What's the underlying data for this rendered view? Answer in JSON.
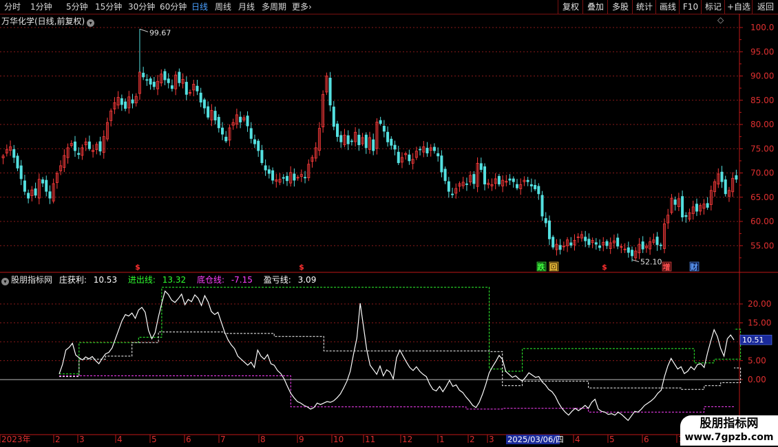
{
  "toolbar": {
    "timeframes": [
      "分时",
      "1分钟",
      "5分钟",
      "15分钟",
      "30分钟",
      "60分钟",
      "日线",
      "周线",
      "月线",
      "多周期",
      "更多"
    ],
    "active": "日线",
    "more_chevron": "›",
    "right_buttons": [
      "复权",
      "叠加",
      "多股",
      "统计",
      "画线",
      "F10",
      "标记",
      "+自选",
      "返回"
    ]
  },
  "main_chart": {
    "title": "万华化学(日线,前复权)",
    "diamond_icon": "◇",
    "max_label": "99.67",
    "min_label": "52.10",
    "y_ticks": [
      "100.0",
      "95.00",
      "90.00",
      "85.00",
      "80.00",
      "75.00",
      "70.00",
      "65.00",
      "60.00",
      "55.00"
    ],
    "markers": [
      {
        "text": "$",
        "color": "#ff3030"
      },
      {
        "text": "$",
        "color": "#ff3030"
      },
      {
        "text": "跌",
        "color": "#40ff40",
        "bg": "#105010"
      },
      {
        "text": "回",
        "color": "#ffd040",
        "bg": "#5a4010"
      },
      {
        "text": "$",
        "color": "#ff3030"
      },
      {
        "text": "增",
        "color": "#ff5050",
        "bg": "#501010"
      },
      {
        "text": "财",
        "color": "#60a0ff",
        "bg": "#102050"
      }
    ]
  },
  "indicator": {
    "name": "股朋指标网",
    "items": [
      {
        "label": "庄获利:",
        "value": "10.53",
        "color": "#ffffff"
      },
      {
        "label": "进出线:",
        "value": "13.32",
        "color": "#30ff30"
      },
      {
        "label": "底仓线:",
        "value": "-7.15",
        "color": "#ff40ff"
      },
      {
        "label": "盈亏线:",
        "value": "3.09",
        "color": "#ffffff"
      }
    ],
    "y_ticks": [
      "20.00",
      "15.00",
      "10.00",
      "5.00",
      "0.00"
    ],
    "current_value": "10.51"
  },
  "x_axis": {
    "labels": [
      "2023年",
      "2",
      "3",
      "4",
      "5",
      "6",
      "7",
      "8",
      "9",
      "10",
      "11",
      "12",
      "1",
      "2",
      "3",
      "4",
      "5",
      "6",
      "7"
    ],
    "highlight": "2025/03/06/四"
  },
  "watermark": {
    "line1": "股朋指标网",
    "line2": "www.7gpzb.com"
  },
  "colors": {
    "up": "#ff3c3c",
    "down": "#54e0e0",
    "grid": "#8b1a1a",
    "axis": "#c01818",
    "green_line": "#30ff30",
    "magenta_line": "#ff40ff"
  },
  "chart_data": {
    "type": "candlestick",
    "close_series": [
      73.5,
      74.8,
      75.4,
      73.2,
      71.0,
      68.8,
      66.2,
      64.8,
      66.5,
      65.4,
      68.7,
      67.9,
      66.2,
      64.8,
      67.8,
      69.9,
      71.5,
      73.6,
      75.2,
      76.1,
      74.6,
      73.8,
      75.2,
      76.4,
      75.0,
      74.7,
      75.9,
      74.5,
      77.5,
      80.4,
      82.8,
      84.5,
      85.6,
      84.1,
      83.3,
      85.7,
      84.4,
      85.8,
      90.8,
      89.8,
      89.1,
      88.3,
      87.8,
      88.9,
      90.4,
      89.2,
      88.6,
      87.4,
      90.2,
      88.6,
      89.3,
      86.2,
      86.6,
      88.3,
      86.9,
      84.6,
      83.4,
      81.5,
      82.9,
      80.9,
      79.3,
      78.0,
      76.6,
      79.3,
      80.4,
      82.0,
      80.5,
      81.4,
      79.7,
      77.1,
      76.0,
      74.6,
      72.1,
      70.6,
      69.9,
      68.5,
      68.6,
      68.7,
      68.9,
      68.4,
      70.1,
      68.5,
      69.1,
      69.7,
      69.0,
      71.8,
      73.2,
      75.2,
      79.2,
      86.2,
      90.0,
      84.0,
      79.6,
      77.5,
      76.4,
      77.8,
      76.0,
      76.5,
      78.4,
      75.8,
      77.3,
      75.2,
      77.3,
      74.6,
      80.5,
      80.2,
      78.6,
      76.4,
      75.7,
      74.9,
      72.1,
      73.2,
      74.0,
      72.5,
      72.8,
      74.5,
      74.8,
      75.4,
      74.1,
      75.2,
      74.6,
      73.5,
      70.2,
      68.4,
      66.2,
      65.5,
      66.8,
      67.8,
      68.1,
      67.6,
      69.5,
      67.8,
      72.0,
      70.7,
      67.7,
      67.9,
      67.6,
      68.8,
      67.7,
      68.5,
      68.3,
      68.5,
      68.2,
      66.9,
      67.6,
      68.5,
      68.2,
      67.3,
      66.7,
      65.7,
      61.1,
      59.7,
      56.4,
      54.7,
      55.3,
      54.2,
      54.9,
      56.2,
      55.1,
      56.1,
      56.8,
      57.3,
      56.0,
      55.2,
      56.1,
      55.3,
      54.6,
      55.7,
      55.0,
      55.6,
      56.0,
      54.9,
      54.8,
      54.3,
      53.6,
      52.9,
      53.9,
      55.3,
      54.3,
      54.9,
      55.8,
      56.2,
      55.2,
      55.0,
      59.5,
      61.3,
      64.8,
      63.5,
      64.7,
      60.9,
      61.0,
      61.8,
      63.0,
      62.1,
      63.3,
      63.6,
      62.9,
      66.4,
      68.2,
      69.8,
      68.2,
      65.7,
      66.4,
      68.9,
      68.7
    ],
    "price_max": 99.67,
    "price_min": 52.1,
    "indicator_series": {
      "庄获利": [
        1.5,
        4,
        7.8,
        8.5,
        9.6,
        6.5,
        5.8,
        5.2,
        6.0,
        5.5,
        6.1,
        5.0,
        4.2,
        5.6,
        6.8,
        7.2,
        8.4,
        10.8,
        13.2,
        15.6,
        17.2,
        16.8,
        17.6,
        16.2,
        18.4,
        19.1,
        17.8,
        13.0,
        10.8,
        12.4,
        16.6,
        20.2,
        23.4,
        22.5,
        21.0,
        20.4,
        21.4,
        22.6,
        19.8,
        21.2,
        20.6,
        22.4,
        21.5,
        19.6,
        22.2,
        20.6,
        18.0,
        17.2,
        17.8,
        15.2,
        12.6,
        10.6,
        9.2,
        8.2,
        6.2,
        5.4,
        4.6,
        3.8,
        4.6,
        3.2,
        7.8,
        6.2,
        5.4,
        6.6,
        4.2,
        3.8,
        2.4,
        1.6,
        0.2,
        -1.8,
        -3.6,
        -4.8,
        -5.8,
        -6.2,
        -6.8,
        -7.2,
        -7.8,
        -7.4,
        -6.2,
        -6.6,
        -6.2,
        -5.8,
        -6.0,
        -5.6,
        -4.8,
        -3.8,
        -2.2,
        -0.4,
        2.2,
        6.8,
        11.0,
        20.2,
        14.0,
        7.8,
        3.8,
        2.6,
        1.4,
        3.6,
        1.0,
        2.6,
        2.0,
        0.2,
        5.8,
        7.8,
        6.2,
        4.6,
        3.2,
        2.4,
        3.4,
        2.2,
        1.4,
        0.8,
        -1.2,
        -2.6,
        -3.0,
        -1.8,
        -3.2,
        -1.8,
        -0.2,
        -1.8,
        -1.4,
        -2.8,
        -3.4,
        -4.6,
        -5.6,
        -6.8,
        -7.4,
        -6.0,
        -3.8,
        -1.2,
        1.8,
        3.4,
        4.8,
        6.4,
        5.4,
        2.2,
        1.4,
        0.6,
        1.0,
        0.2,
        -0.4,
        0.6,
        1.8,
        1.2,
        0.6,
        0.8,
        -0.6,
        -1.4,
        -2.6,
        -3.2,
        -4.4,
        -6.2,
        -7.6,
        -8.6,
        -9.4,
        -8.4,
        -7.6,
        -8.2,
        -7.6,
        -6.8,
        -7.6,
        -6.0,
        -5.2,
        -7.8,
        -8.4,
        -8.6,
        -9.2,
        -9.0,
        -9.4,
        -8.6,
        -9.2,
        -10.0,
        -10.8,
        -9.6,
        -8.4,
        -8.6,
        -7.8,
        -6.8,
        -6.2,
        -5.6,
        -4.8,
        -3.6,
        -2.8,
        0.8,
        3.6,
        5.6,
        4.2,
        2.8,
        3.4,
        1.6,
        2.2,
        3.4,
        2.6,
        4.0,
        4.2,
        3.2,
        7.0,
        10.2,
        13.2,
        11.4,
        8.2,
        6.2,
        10.8,
        11.8,
        10.5
      ],
      "进出线_steps": [
        [
          0,
          1.5
        ],
        [
          6,
          9.8
        ],
        [
          24,
          11.2
        ],
        [
          31,
          24.4
        ],
        [
          130,
          2.8
        ],
        [
          134,
          2.2
        ],
        [
          140,
          8.2
        ],
        [
          192,
          4.4
        ],
        [
          198,
          5.4
        ],
        [
          206,
          13.32
        ]
      ],
      "底仓线_steps": [
        [
          0,
          1.0
        ],
        [
          70,
          -7.2
        ],
        [
          123,
          -7.8
        ],
        [
          134,
          -7.6
        ],
        [
          160,
          -8.6
        ],
        [
          195,
          -7.15
        ]
      ],
      "盈亏线_steps": [
        [
          0,
          0.8
        ],
        [
          6,
          5.4
        ],
        [
          14,
          6.2
        ],
        [
          22,
          9.8
        ],
        [
          30,
          12.6
        ],
        [
          50,
          12.2
        ],
        [
          65,
          11.4
        ],
        [
          80,
          7.6
        ],
        [
          130,
          7.4
        ],
        [
          134,
          -1.6
        ],
        [
          140,
          -0.4
        ],
        [
          160,
          -2.2
        ],
        [
          188,
          -2.6
        ],
        [
          195,
          -1.6
        ],
        [
          200,
          -0.8
        ],
        [
          206,
          3.09
        ]
      ]
    }
  }
}
